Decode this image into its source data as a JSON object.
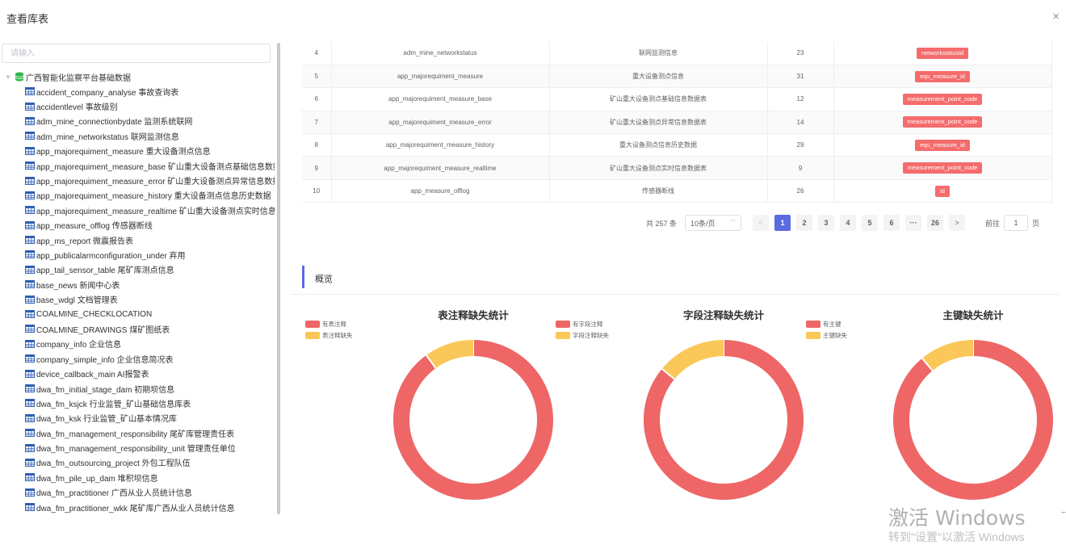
{
  "dialog": {
    "title": "查看库表",
    "close_icon": "×"
  },
  "tree": {
    "search_placeholder": "请输入",
    "root_label": "广西智能化监察平台基础数据",
    "items": [
      "accident_company_analyse 事故查询表",
      "accidentlevel 事故级别",
      "adm_mine_connectionbydate 监测系统联网",
      "adm_mine_networkstatus 联网监测信息",
      "app_majorequiment_measure 重大设备测点信息",
      "app_majorequiment_measure_base 矿山重大设备测点基础信息数据",
      "app_majorequiment_measure_error 矿山重大设备测点异常信息数据",
      "app_majorequiment_measure_history 重大设备测点信息历史数据",
      "app_majorequiment_measure_realtime 矿山重大设备测点实时信息",
      "app_measure_offlog 传感器断线",
      "app_ms_report 微震报告表",
      "app_publicalarmconfiguration_under 弃用",
      "app_tail_sensor_table 尾矿库测点信息",
      "base_news 新闻中心表",
      "base_wdgl 文档管理表",
      "COALMINE_CHECKLOCATION",
      "COALMINE_DRAWINGS 煤矿图纸表",
      "company_info 企业信息",
      "company_simple_info 企业信息简况表",
      "device_callback_main AI报警表",
      "dwa_fm_initial_stage_dam 初期坝信息",
      "dwa_fm_ksjck 行业监管_矿山基础信息库表",
      "dwa_fm_ksk 行业监管_矿山基本情况库",
      "dwa_fm_management_responsibility 尾矿库管理责任表",
      "dwa_fm_management_responsibility_unit 管理责任单位",
      "dwa_fm_outsourcing_project 外包工程队伍",
      "dwa_fm_pile_up_dam 堆积坝信息",
      "dwa_fm_practitioner 广西从业人员统计信息",
      "dwa_fm_practitioner_wkk 尾矿库广西从业人员统计信息"
    ]
  },
  "table": {
    "rows": [
      {
        "no": "4",
        "name": "adm_mine_networkstatus",
        "comment": "联网监测信息",
        "fields": "23",
        "pk": "networkstatusid"
      },
      {
        "no": "5",
        "name": "app_majorequiment_measure",
        "comment": "重大设备测点信息",
        "fields": "31",
        "pk": "equ_measure_id"
      },
      {
        "no": "6",
        "name": "app_majorequiment_measure_base",
        "comment": "矿山重大设备测点基础信息数据表",
        "fields": "12",
        "pk": "measurement_point_code"
      },
      {
        "no": "7",
        "name": "app_majorequiment_measure_error",
        "comment": "矿山重大设备测点异常信息数据表",
        "fields": "14",
        "pk": "measurement_point_code"
      },
      {
        "no": "8",
        "name": "app_majorequiment_measure_history",
        "comment": "重大设备测点信息历史数据",
        "fields": "29",
        "pk": "equ_measure_id"
      },
      {
        "no": "9",
        "name": "app_majorequiment_measure_realtime",
        "comment": "矿山重大设备测点实时信息数据表",
        "fields": "9",
        "pk": "measurement_point_code"
      },
      {
        "no": "10",
        "name": "app_measure_offlog",
        "comment": "传感器断线",
        "fields": "26",
        "pk": "id"
      }
    ]
  },
  "pagination": {
    "total": "共 257 条",
    "page_size": "10条/页",
    "prev": "<",
    "next": ">",
    "pages": [
      "1",
      "2",
      "3",
      "4",
      "5",
      "6",
      "···",
      "26"
    ],
    "current": "1",
    "goto_prefix": "前往",
    "goto_value": "1",
    "goto_suffix": "页"
  },
  "overview": {
    "title": "概览"
  },
  "colors": {
    "primary": "#5b6be0",
    "red": "#ee6666",
    "yellow": "#fac858",
    "tag": "#f56c6c"
  },
  "chart_data": [
    {
      "type": "pie",
      "title": "表注释缺失统计",
      "labels": [
        "有表注释",
        "表注释缺失"
      ],
      "values": [
        0.9,
        0.1
      ]
    },
    {
      "type": "pie",
      "title": "字段注释缺失统计",
      "labels": [
        "有字段注释",
        "字段注释缺失"
      ],
      "values": [
        0.86,
        0.14
      ]
    },
    {
      "type": "pie",
      "title": "主键缺失统计",
      "labels": [
        "有主键",
        "主键缺失"
      ],
      "values": [
        0.89,
        0.11
      ]
    }
  ],
  "watermark": {
    "line1": "激活 Windows",
    "line2": "转到\"设置\"以激活 Windows",
    "arrow": "←"
  }
}
